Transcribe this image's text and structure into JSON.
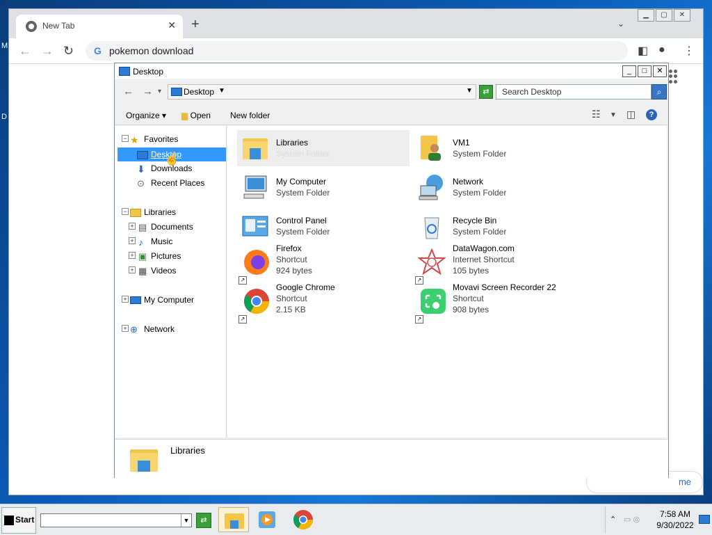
{
  "chrome": {
    "tab_title": "New Tab",
    "tab_close": "✕",
    "new_tab": "+",
    "tab_search": "⌄",
    "address": "pokemon download",
    "customize_partial": "me"
  },
  "explorer": {
    "title": "Desktop",
    "address": "Desktop",
    "search_placeholder": "Search Desktop",
    "commands": {
      "organize": "Organize",
      "open": "Open",
      "new_folder": "New folder"
    },
    "nav": {
      "favorites": "Favorites",
      "desktop": "Desktop",
      "downloads": "Downloads",
      "recent": "Recent Places",
      "libraries": "Libraries",
      "documents": "Documents",
      "music": "Music",
      "pictures": "Pictures",
      "videos": "Videos",
      "my_computer": "My Computer",
      "network": "Network"
    },
    "items": [
      {
        "name": "Libraries",
        "type": "System Folder",
        "size": ""
      },
      {
        "name": "VM1",
        "type": "System Folder",
        "size": ""
      },
      {
        "name": "My Computer",
        "type": "System Folder",
        "size": ""
      },
      {
        "name": "Network",
        "type": "System Folder",
        "size": ""
      },
      {
        "name": "Control Panel",
        "type": "System Folder",
        "size": ""
      },
      {
        "name": "Recycle Bin",
        "type": "System Folder",
        "size": ""
      },
      {
        "name": "Firefox",
        "type": "Shortcut",
        "size": "924 bytes"
      },
      {
        "name": "DataWagon.com",
        "type": "Internet Shortcut",
        "size": "105 bytes"
      },
      {
        "name": "Google Chrome",
        "type": "Shortcut",
        "size": "2.15 KB"
      },
      {
        "name": "Movavi Screen Recorder 22",
        "type": "Shortcut",
        "size": "908 bytes"
      }
    ],
    "details_name": "Libraries"
  },
  "taskbar": {
    "start": "Start",
    "time": "7:58 AM",
    "date": "9/30/2022"
  },
  "colors": {
    "selection": "#3399ff",
    "accent": "#1a73e8"
  }
}
